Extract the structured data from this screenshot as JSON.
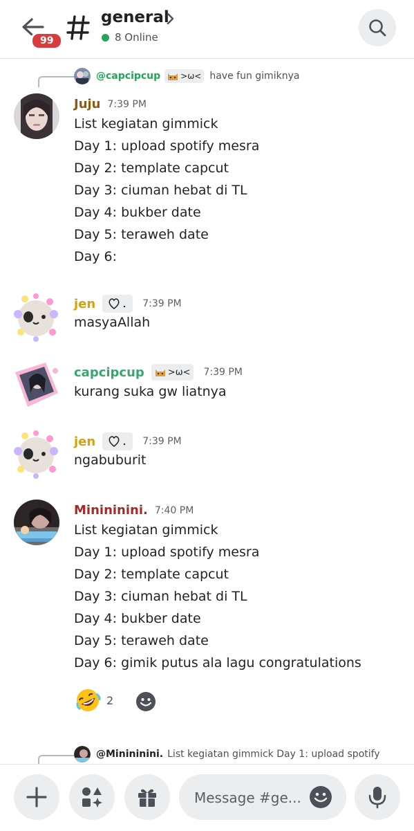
{
  "header": {
    "back_icon": "arrow-left-icon",
    "badge_count": "99",
    "channel_icon": "hash-icon",
    "channel_name": "general",
    "online_text": "8 Online",
    "search_icon": "search-icon"
  },
  "colors": {
    "online_green": "#23a55a",
    "badge_red": "#d83c3e",
    "juju": "#8b5a16",
    "jen": "#d4a20b",
    "capcipcup": "#3aa66f",
    "minininini": "#a12b2b"
  },
  "reply1": {
    "name": "@capcipcup",
    "tag": ">ω<",
    "text": "have fun gimiknya"
  },
  "messages": [
    {
      "user": "Juju",
      "time": "7:39 PM",
      "lines": [
        "List kegiatan gimmick",
        "Day 1: upload spotify mesra",
        "Day 2: template capcut",
        "Day 3: ciuman hebat di TL",
        "Day 4: bukber date",
        "Day 5: teraweh date",
        "Day 6:"
      ]
    },
    {
      "user": "jen",
      "time": "7:39 PM",
      "lines": [
        "masyaAllah"
      ]
    },
    {
      "user": "capcipcup",
      "tag": ">ω<",
      "time": "7:39 PM",
      "lines": [
        "kurang suka gw liatnya"
      ]
    },
    {
      "user": "jen",
      "time": "7:39 PM",
      "lines": [
        "ngabuburit"
      ]
    },
    {
      "user": "Minininini.",
      "time": "7:40 PM",
      "lines": [
        "List kegiatan gimmick",
        "Day 1: upload spotify mesra",
        "Day 2: template capcut",
        "Day 3: ciuman hebat di TL",
        "Day 4: bukber date",
        "Day 5: teraweh date",
        "Day 6: gimik putus ala lagu congratulations"
      ]
    }
  ],
  "reaction": {
    "emoji": "rolling-on-floor-laughing-icon",
    "count": "2"
  },
  "reply2": {
    "name": "@Minininini.",
    "text": "List kegiatan gimmick Day 1: upload spotify"
  },
  "composer": {
    "placeholder": "Message #ge...",
    "buttons": [
      "plus-icon",
      "apps-icon",
      "gift-icon",
      "emoji-icon",
      "microphone-icon"
    ]
  }
}
